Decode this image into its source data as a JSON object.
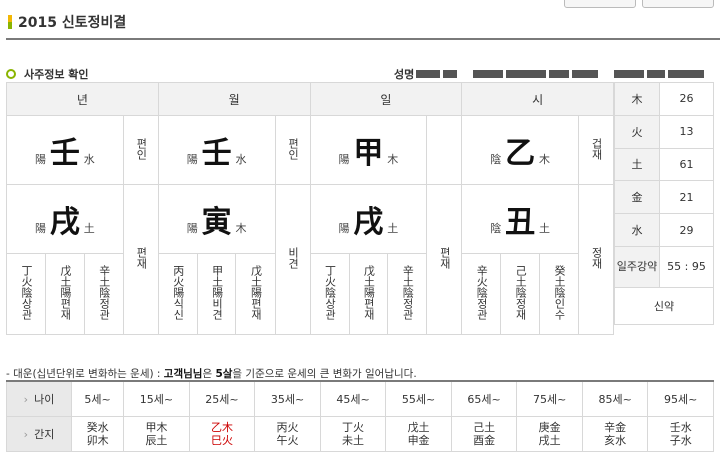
{
  "page_title": "2015 신토정비결",
  "section_title": "사주정보 확인",
  "name_label": "성명",
  "pillars": [
    {
      "header": "년",
      "stem": "壬",
      "stem_yy": "陽",
      "stem_el": "水",
      "stem_god": "편인",
      "branch": "戌",
      "branch_yy": "陽",
      "branch_el": "土",
      "branch_god": "편재",
      "hidden": [
        "丁火陰상관",
        "戊土陽편재",
        "辛土陰정관"
      ]
    },
    {
      "header": "월",
      "stem": "壬",
      "stem_yy": "陽",
      "stem_el": "水",
      "stem_god": "편인",
      "branch": "寅",
      "branch_yy": "陽",
      "branch_el": "木",
      "branch_god": "비견",
      "hidden": [
        "丙火陽식신",
        "甲土陽비견",
        "戊土陽편재"
      ]
    },
    {
      "header": "일",
      "stem": "甲",
      "stem_yy": "陽",
      "stem_el": "木",
      "stem_god": "",
      "branch": "戌",
      "branch_yy": "陽",
      "branch_el": "土",
      "branch_god": "편재",
      "hidden": [
        "丁火陰상관",
        "戊土陽편재",
        "辛土陰정관"
      ]
    },
    {
      "header": "시",
      "stem": "乙",
      "stem_yy": "陰",
      "stem_el": "木",
      "stem_god": "겁재",
      "branch": "丑",
      "branch_yy": "陰",
      "branch_el": "土",
      "branch_god": "정재",
      "hidden": [
        "辛火陰정관",
        "己土陰정재",
        "癸土陰인수"
      ]
    }
  ],
  "elements": [
    {
      "label": "木",
      "value": "26"
    },
    {
      "label": "火",
      "value": "13"
    },
    {
      "label": "土",
      "value": "61"
    },
    {
      "label": "金",
      "value": "21"
    },
    {
      "label": "水",
      "value": "29"
    }
  ],
  "strength": {
    "label": "일주강약",
    "value": "55 : 95",
    "result": "신약"
  },
  "daewoon_note": {
    "prefix": "- 대운(십년단위로 변화하는 운세) : ",
    "name": "고객님님",
    "mid": "은 ",
    "age": "5살",
    "suffix": "을 기준으로 운세의 큰 변화가 일어납니다."
  },
  "daewoon": {
    "age_label": "나이",
    "ganji_label": "간지",
    "ages": [
      "5세~",
      "15세~",
      "25세~",
      "35세~",
      "45세~",
      "55세~",
      "65세~",
      "75세~",
      "85세~",
      "95세~"
    ],
    "ganji": [
      [
        "癸水",
        "卯木"
      ],
      [
        "甲木",
        "辰土"
      ],
      [
        "乙木",
        "巳火"
      ],
      [
        "丙火",
        "午火"
      ],
      [
        "丁火",
        "未土"
      ],
      [
        "戊土",
        "申金"
      ],
      [
        "己土",
        "酉金"
      ],
      [
        "庚金",
        "戌土"
      ],
      [
        "辛金",
        "亥水"
      ],
      [
        "壬水",
        "子水"
      ]
    ],
    "highlight_index": 2,
    "highlight_color": "#cc0000"
  },
  "colors": {
    "accent_green": "#8ab400",
    "accent_yellow": "#f2b705",
    "header_bg": "#f2f2f2"
  }
}
